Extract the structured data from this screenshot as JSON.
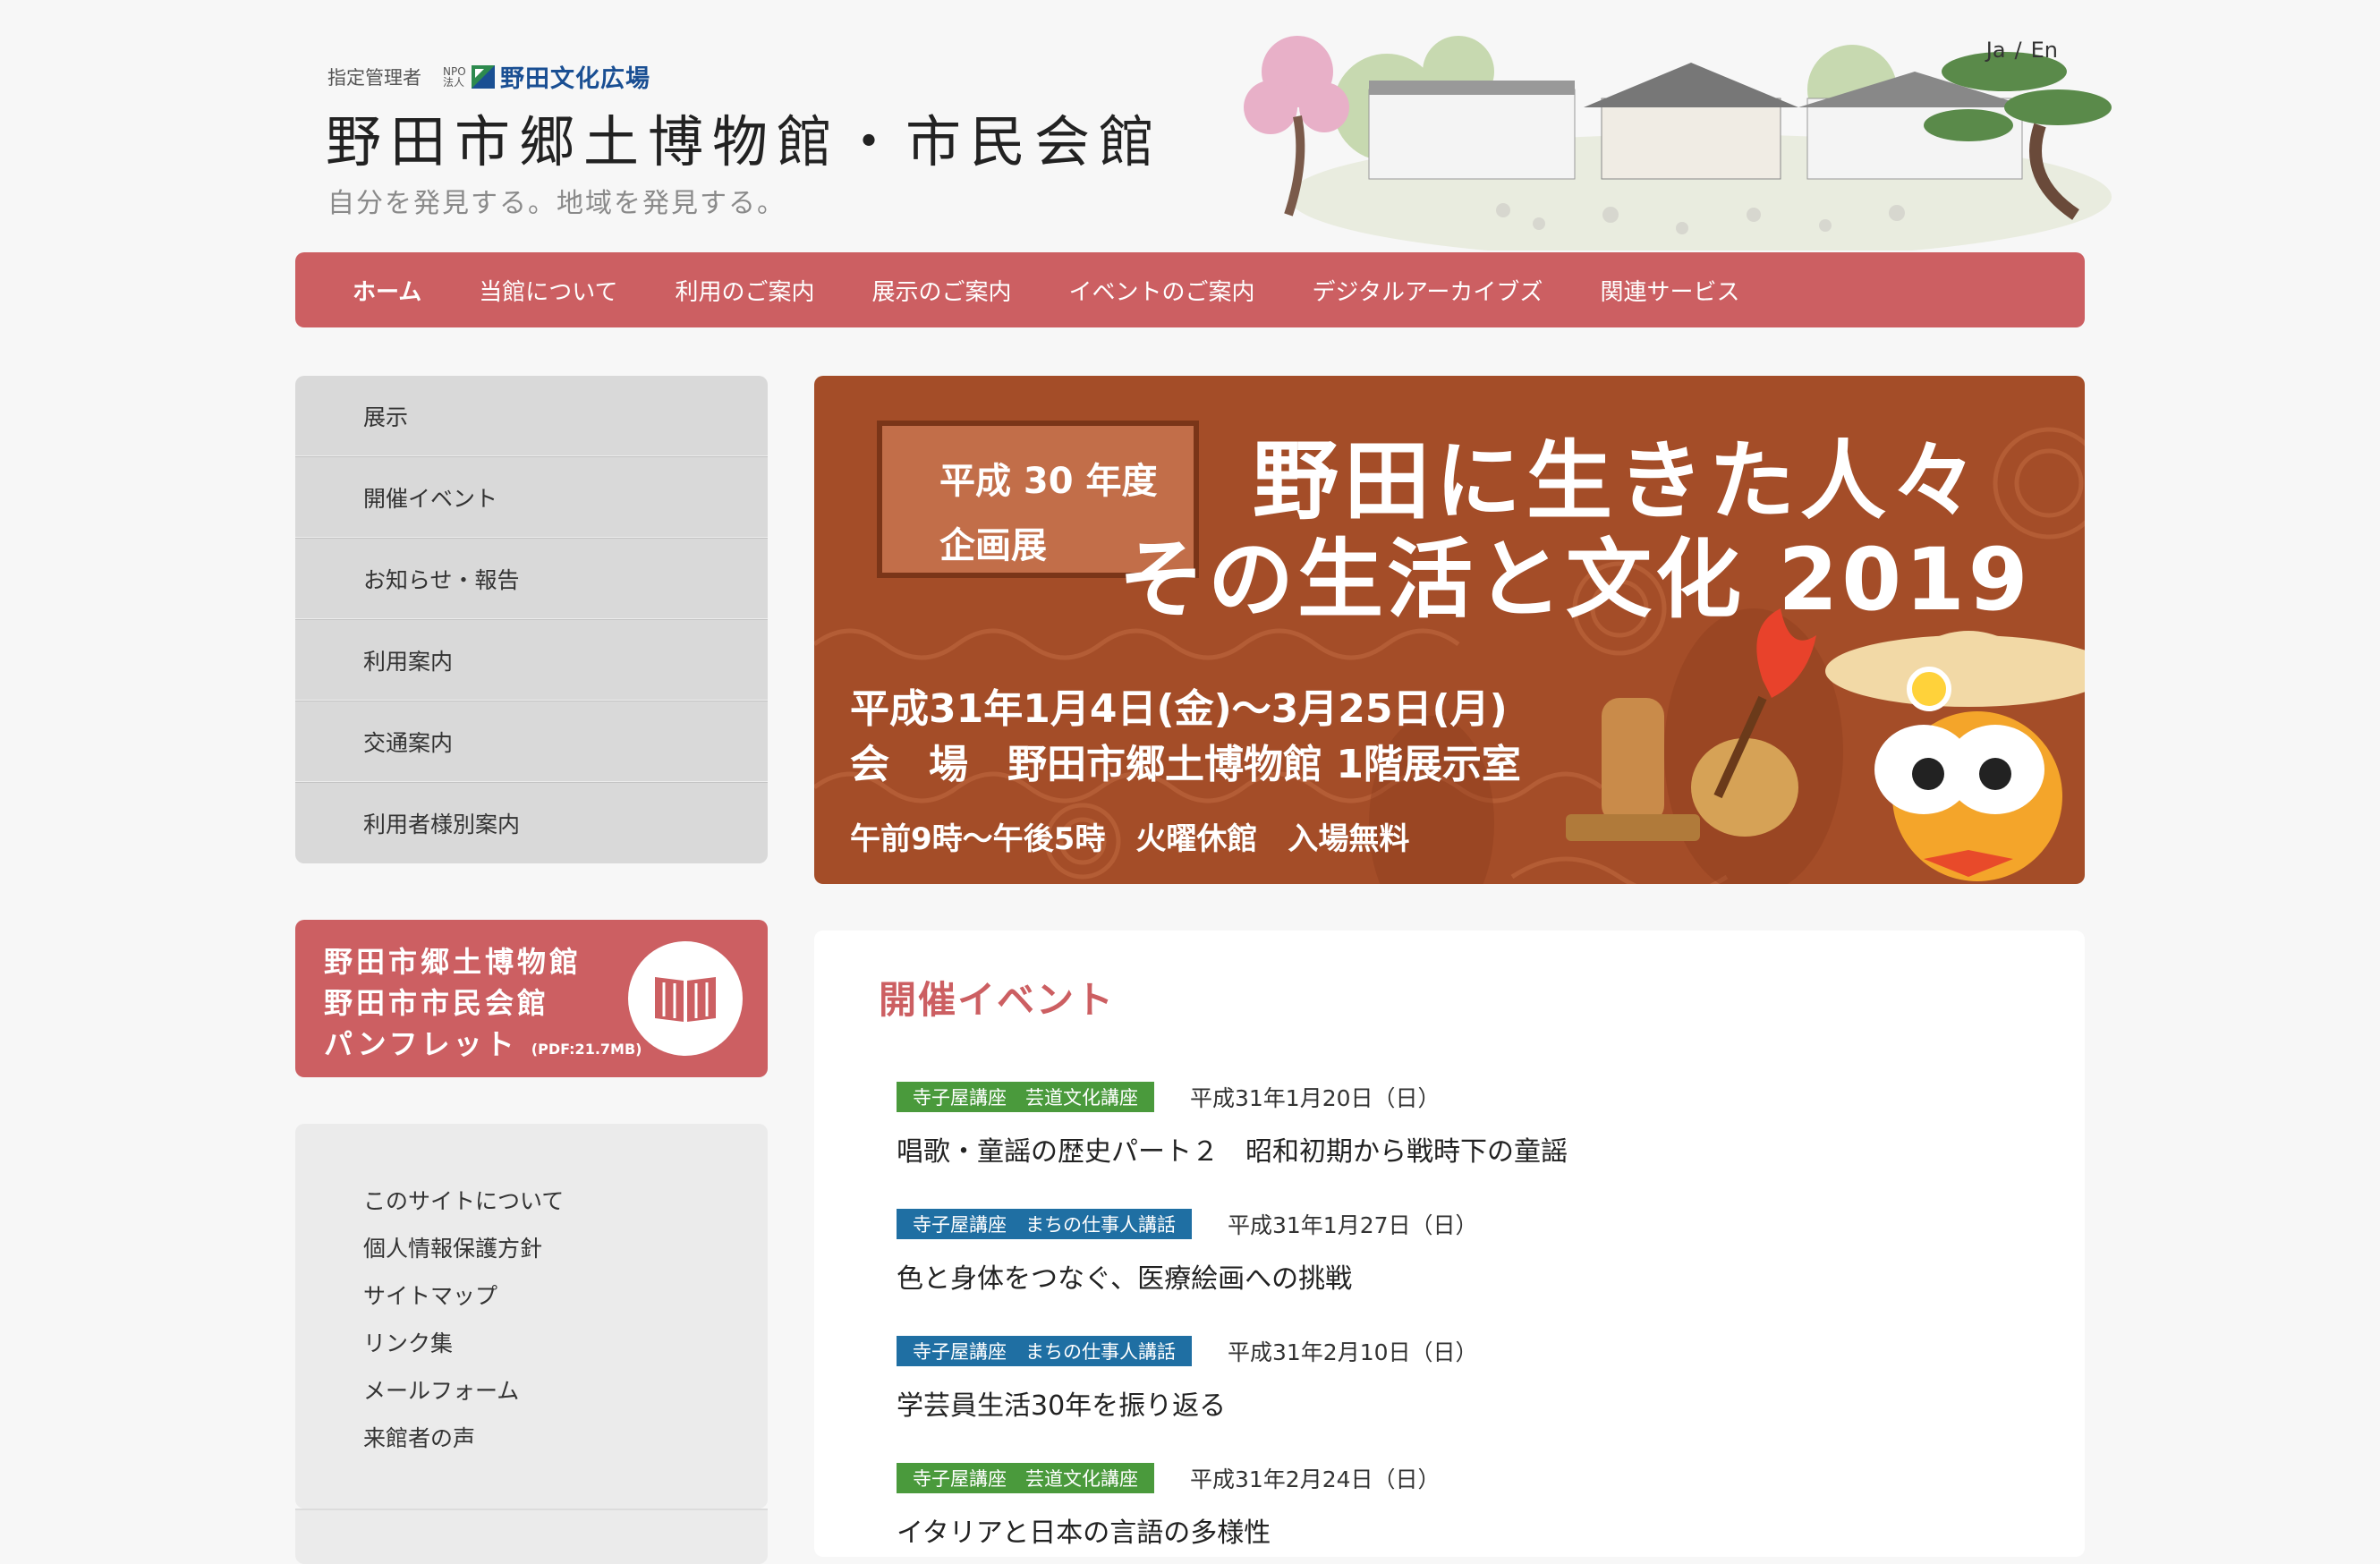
{
  "header": {
    "manager_label": "指定管理者",
    "npo_small": "NPO法人",
    "npo_name": "野田文化広場",
    "site_title": "野田市郷土博物館・市民会館",
    "tagline": "自分を発見する。地域を発見する。",
    "lang": [
      "Ja",
      "/",
      "En"
    ]
  },
  "nav": {
    "items": [
      "ホーム",
      "当館について",
      "利用のご案内",
      "展示のご案内",
      "イベントのご案内",
      "デジタルアーカイブズ",
      "関連サービス"
    ]
  },
  "sidebar": {
    "menu": [
      "展示",
      "開催イベント",
      "お知らせ・報告",
      "利用案内",
      "交通案内",
      "利用者様別案内"
    ],
    "pamphlet": {
      "line1": "野田市郷土博物館",
      "line2": "野田市市民会館",
      "line3": "パンフレット",
      "pdf": "(PDF:21.7MB)",
      "icon": "book-icon"
    },
    "links": [
      "このサイトについて",
      "個人情報保護方針",
      "サイトマップ",
      "リンク集",
      "メールフォーム",
      "来館者の声"
    ]
  },
  "banner": {
    "label1": "平成 30 年度",
    "label2": "企画展",
    "title1": "野田に生きた人々",
    "title2": "その生活と文化 2019",
    "date": "平成31年1月4日(金)～3月25日(月)",
    "venue": "会　場　野田市郷土博物館 1階展示室",
    "hours": "午前9時～午後5時　火曜休館　入場無料"
  },
  "events": {
    "heading": "開催イベント",
    "items": [
      {
        "tag": "寺子屋講座　芸道文化講座",
        "tag_color": "#4a9a3c",
        "date": "平成31年1月20日（日）",
        "title": "唱歌・童謡の歴史パート２　昭和初期から戦時下の童謡"
      },
      {
        "tag": "寺子屋講座　まちの仕事人講話",
        "tag_color": "#1f6fa3",
        "date": "平成31年1月27日（日）",
        "title": "色と身体をつなぐ、医療絵画への挑戦"
      },
      {
        "tag": "寺子屋講座　まちの仕事人講話",
        "tag_color": "#1f6fa3",
        "date": "平成31年2月10日（日）",
        "title": "学芸員生活30年を振り返る"
      },
      {
        "tag": "寺子屋講座　芸道文化講座",
        "tag_color": "#4a9a3c",
        "date": "平成31年2月24日（日）",
        "title": "イタリアと日本の言語の多様性"
      }
    ]
  },
  "colors": {
    "accent": "#cc5f62",
    "banner_bg": "#a44d28",
    "tag_green": "#4a9a3c",
    "tag_blue": "#1f6fa3"
  }
}
